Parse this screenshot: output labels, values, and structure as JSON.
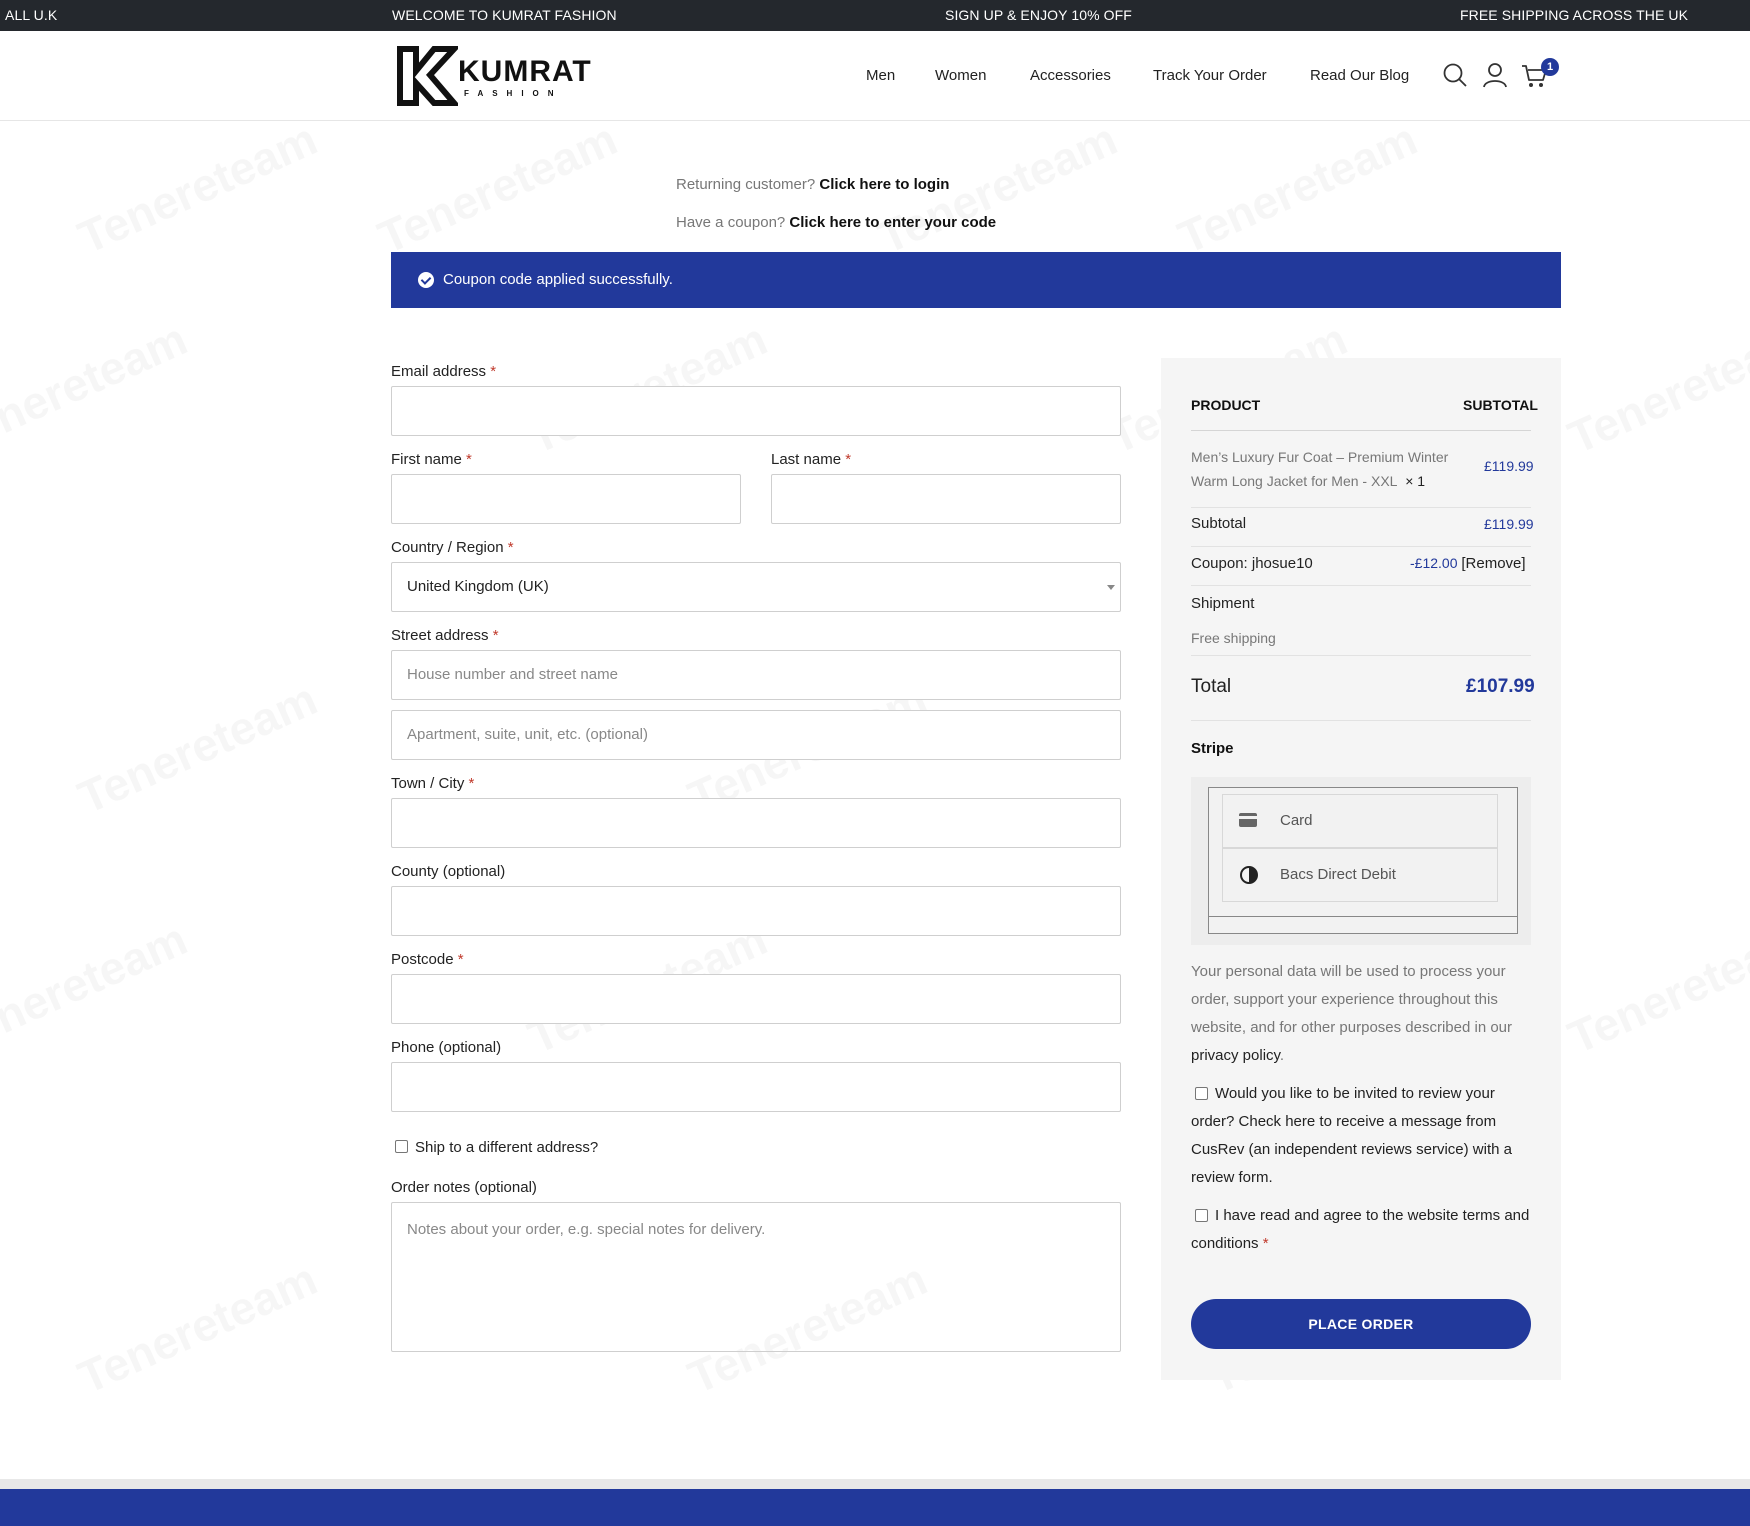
{
  "topbar": {
    "left": "ALL U.K",
    "welcome": "WELCOME TO KUMRAT FASHION",
    "promo": "SIGN UP & ENJOY 10% OFF",
    "shipping": "FREE SHIPPING ACROSS THE UK"
  },
  "header": {
    "logo_word": "KUMRAT",
    "logo_sub": "FASHION",
    "nav": [
      "Men",
      "Women",
      "Accessories",
      "Track Your Order",
      "Read Our Blog"
    ],
    "cart_count": "1"
  },
  "watermark": "Tenereteam",
  "prelude": {
    "returning_text": "Returning customer?",
    "returning_link": "Click here to login",
    "coupon_text": "Have a coupon?",
    "coupon_link": "Click here to enter your code"
  },
  "notice": "Coupon code applied successfully.",
  "form": {
    "required_mark": "*",
    "email_label": "Email address",
    "first_name_label": "First name",
    "last_name_label": "Last name",
    "country_label": "Country / Region",
    "country_value": "United Kingdom (UK)",
    "street_label": "Street address",
    "street_placeholder": "House number and street name",
    "street2_placeholder": "Apartment, suite, unit, etc. (optional)",
    "city_label": "Town / City",
    "county_label": "County (optional)",
    "postcode_label": "Postcode",
    "phone_label": "Phone (optional)",
    "ship_different": "Ship to a different address?",
    "notes_label": "Order notes (optional)",
    "notes_placeholder": "Notes about your order, e.g. special notes for delivery."
  },
  "review": {
    "col_product": "PRODUCT",
    "col_subtotal": "SUBTOTAL",
    "item_name_line1": "Men’s Luxury Fur Coat – Premium Winter",
    "item_name_line2": "Warm Long Jacket for Men - XXL",
    "item_qty": "× 1",
    "item_price": "£119.99",
    "subtotal_label": "Subtotal",
    "subtotal_value": "£119.99",
    "coupon_label": "Coupon: jhosue10",
    "coupon_value": "-£12.00",
    "coupon_remove": "[Remove]",
    "shipment_label": "Shipment",
    "shipment_value": "Free shipping",
    "total_label": "Total",
    "total_value": "£107.99",
    "payment_title": "Stripe",
    "payment_methods": [
      "Card",
      "Bacs Direct Debit"
    ],
    "privacy_text": "Your personal data will be used to process your order, support your experience throughout this website, and for other purposes described in our",
    "privacy_link": "privacy policy",
    "privacy_end": ".",
    "review_invite": "Would you like to be invited to review your order? Check here to receive a message from CusRev (an independent reviews service) with a review form.",
    "terms": "I have read and agree to the website terms and conditions",
    "place_order": "PLACE ORDER"
  },
  "colors": {
    "brand_blue": "#22399b",
    "topbar": "#24282d",
    "review_bg": "#f5f5f5"
  }
}
